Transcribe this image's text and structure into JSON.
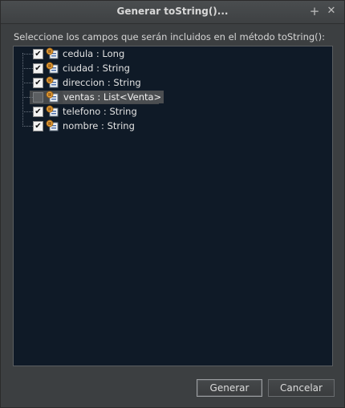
{
  "window": {
    "title": "Generar toString()...",
    "maximize_glyph": "+",
    "close_glyph": "✕"
  },
  "prompt": "Seleccione los campos que serán incluidos en el método toString():",
  "fields": [
    {
      "label": "cedula : Long",
      "checked": true,
      "icon": "field-icon"
    },
    {
      "label": "ciudad : String",
      "checked": true,
      "icon": "field-icon"
    },
    {
      "label": "direccion : String",
      "checked": true,
      "icon": "field-icon"
    },
    {
      "label": "ventas : List<Venta>",
      "checked": false,
      "selected": true,
      "icon": "field-icon"
    },
    {
      "label": "telefono : String",
      "checked": true,
      "icon": "field-icon"
    },
    {
      "label": "nombre : String",
      "checked": true,
      "icon": "field-icon"
    }
  ],
  "buttons": {
    "generate": "Generar",
    "cancel": "Cancelar"
  },
  "colors": {
    "tree_background": "#0f1a27",
    "window_background": "#3c3f41",
    "selection": "#4b4e51"
  }
}
